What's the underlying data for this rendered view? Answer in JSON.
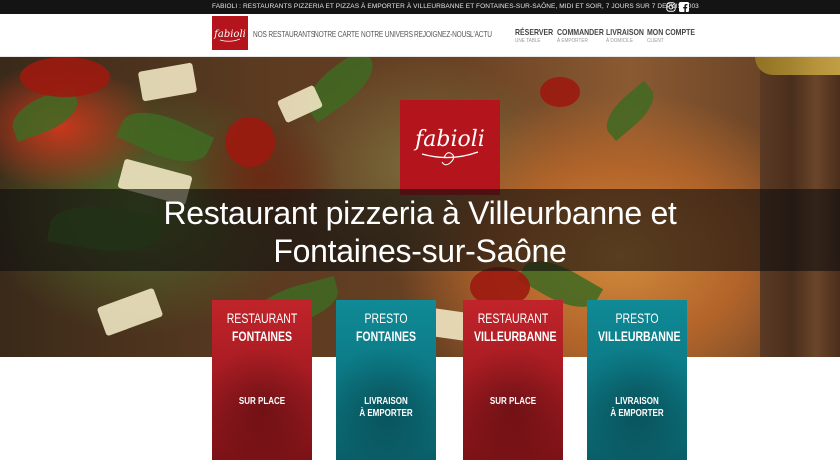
{
  "topbar": {
    "text": "FABIOLI : RESTAURANTS PIZZERIA ET PIZZAS À EMPORTER À VILLEURBANNE ET FONTAINES-SUR-SAÔNE, MIDI ET SOIR, 7 JOURS SUR 7 DEPUIS 2003",
    "icons": [
      "instagram-icon",
      "facebook-icon"
    ]
  },
  "header": {
    "logo_text": "fabioli",
    "nav": [
      {
        "label": "NOS RESTAURANTS"
      },
      {
        "label": "NOTRE CARTE"
      },
      {
        "label": "NOTRE UNIVERS"
      },
      {
        "label": "REJOIGNEZ-NOUS"
      },
      {
        "label": "L'ACTU"
      }
    ],
    "actions": [
      {
        "label": "RÉSERVER",
        "sub": "UNE TABLE"
      },
      {
        "label": "COMMANDER",
        "sub": "À EMPORTER"
      },
      {
        "label": "LIVRAISON",
        "sub": "À DOMICILE"
      },
      {
        "label": "MON COMPTE",
        "sub": "CLIENT"
      }
    ]
  },
  "hero": {
    "logo_text": "fabioli",
    "title_line1": "Restaurant pizzeria à Villeurbanne et",
    "title_line2": "Fontaines-sur-Saône"
  },
  "cards": [
    {
      "line1": "RESTAURANT",
      "line2": "FONTAINES",
      "bottom1": "SUR PLACE",
      "bottom2": "",
      "color": "#b01e24"
    },
    {
      "line1": "PRESTO",
      "line2": "FONTAINES",
      "bottom1": "LIVRAISON",
      "bottom2": "À EMPORTER",
      "color": "#0e8290"
    },
    {
      "line1": "RESTAURANT",
      "line2": "VILLEURBANNE",
      "bottom1": "SUR PLACE",
      "bottom2": "",
      "color": "#b01e24"
    },
    {
      "line1": "PRESTO",
      "line2": "VILLEURBANNE",
      "bottom1": "LIVRAISON",
      "bottom2": "À EMPORTER",
      "color": "#0e8290"
    }
  ],
  "colors": {
    "brand_red": "#b4141c",
    "teal": "#0e8290",
    "topbar": "#141414"
  }
}
